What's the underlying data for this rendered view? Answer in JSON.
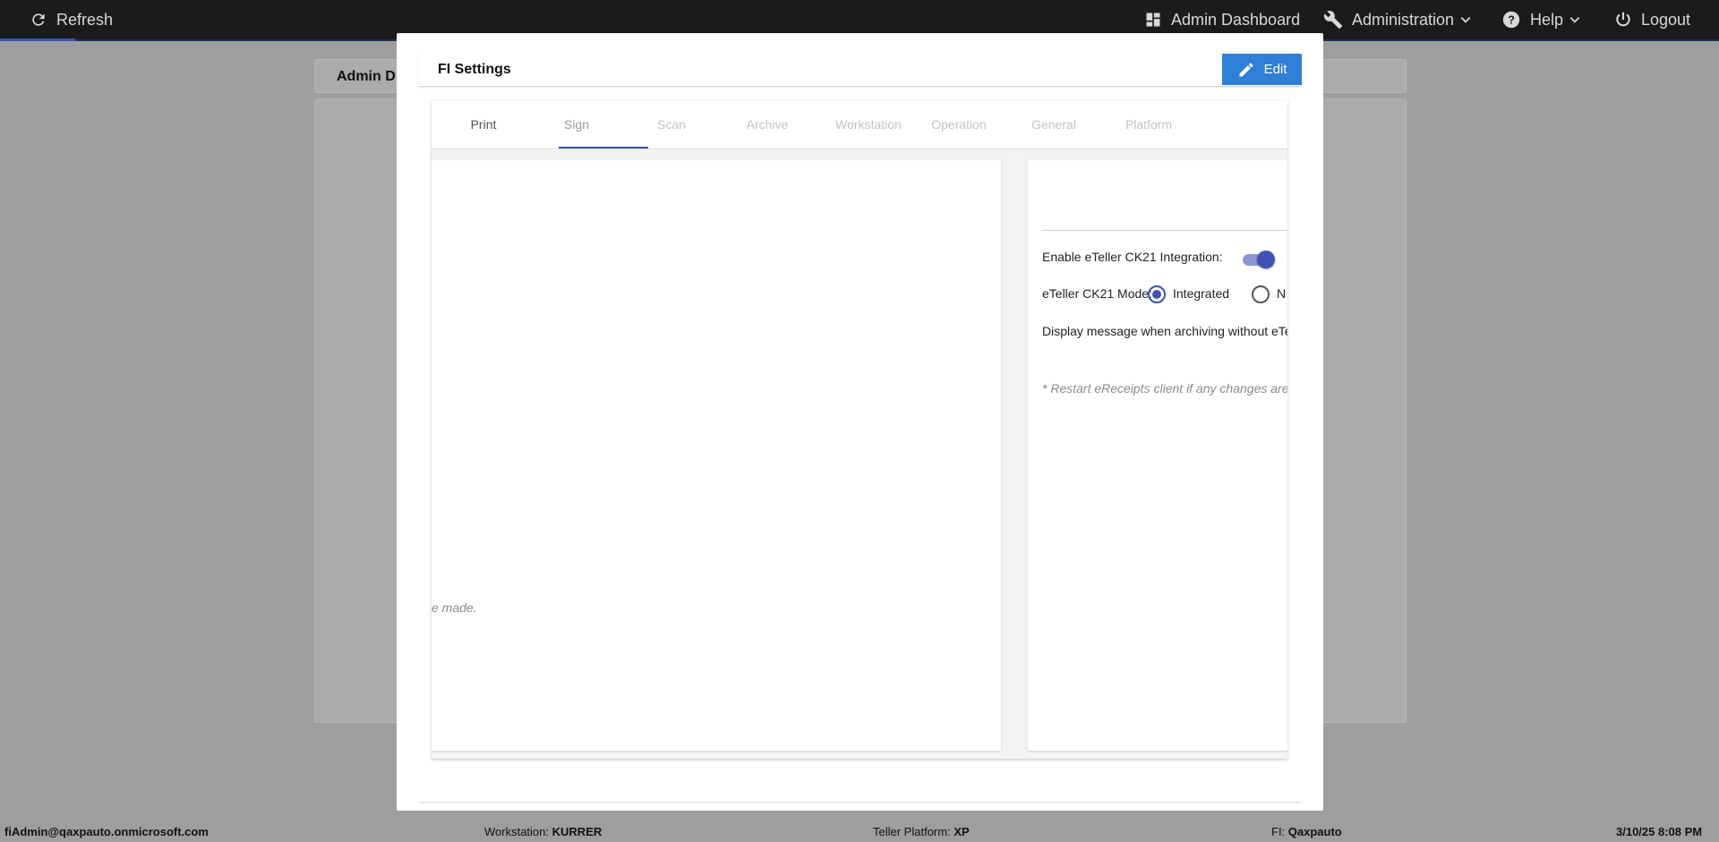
{
  "topbar": {
    "refresh_label": "Refresh",
    "admin_dashboard_label": "Admin Dashboard",
    "administration_label": "Administration",
    "help_label": "Help",
    "logout_label": "Logout"
  },
  "background": {
    "header_title": "Admin D"
  },
  "modal": {
    "title": "FI Settings",
    "edit_label": "Edit",
    "tabs": [
      {
        "label": "Print"
      },
      {
        "label": "Sign"
      },
      {
        "label": "Scan"
      },
      {
        "label": "Archive"
      },
      {
        "label": "Workstation"
      },
      {
        "label": "Operation"
      },
      {
        "label": "General"
      },
      {
        "label": "Platform"
      }
    ],
    "active_tab": "Sign",
    "left_pane": {
      "note_fragment": "e made."
    },
    "right_pane": {
      "enable_integration_label": "Enable eTeller CK21 Integration:",
      "enable_integration_on": true,
      "mode_label": "eTeller CK21 Mode:",
      "mode_options": [
        {
          "label": "Integrated",
          "checked": true
        },
        {
          "label": "N",
          "checked": false
        }
      ],
      "display_message_label": "Display message when archiving without eTe",
      "restart_note": "* Restart eReceipts client if any changes are"
    }
  },
  "statusbar": {
    "user": "fiAdmin@qaxpauto.onmicrosoft.com",
    "workstation_label": "Workstation:",
    "workstation_value": "KURRER",
    "platform_label": "Teller Platform:",
    "platform_value": "XP",
    "fi_label": "FI:",
    "fi_value": "Qaxpauto",
    "datetime": "3/10/25 8:08 PM"
  },
  "colors": {
    "accent": "#3f51b5",
    "edit_button": "#2f7fd6",
    "topbar": "#1b1b1b",
    "overlay": "#9e9e9e"
  }
}
